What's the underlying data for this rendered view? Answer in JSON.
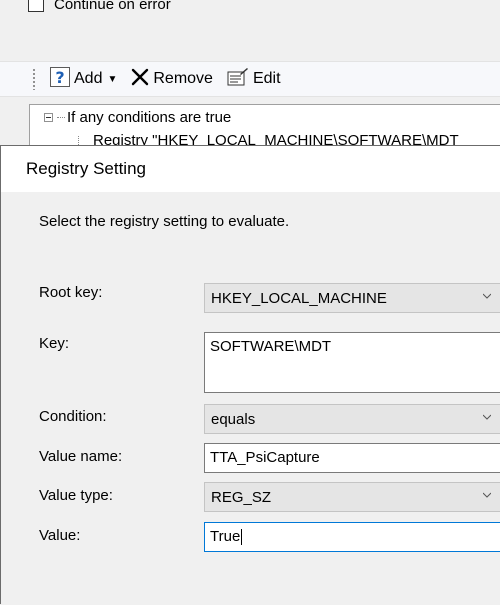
{
  "background": {
    "continue_on_error_label": "Continue on error",
    "toolbar": {
      "add_label": "Add",
      "remove_label": "Remove",
      "edit_label": "Edit"
    },
    "tree": {
      "root_label": "If any conditions are true",
      "child_label": "Registry \"HKEY_LOCAL_MACHINE\\SOFTWARE\\MDT"
    }
  },
  "dialog": {
    "title": "Registry Setting",
    "instruction": "Select the registry setting to evaluate.",
    "root_key": {
      "label": "Root key:",
      "value": "HKEY_LOCAL_MACHINE"
    },
    "key": {
      "label": "Key:",
      "value": "SOFTWARE\\MDT"
    },
    "condition": {
      "label": "Condition:",
      "value": "equals"
    },
    "value_name": {
      "label": "Value name:",
      "value": "TTA_PsiCapture"
    },
    "value_type": {
      "label": "Value type:",
      "value": "REG_SZ"
    },
    "value": {
      "label": "Value:",
      "value": "True"
    }
  },
  "icons": [
    "help-add-icon",
    "dropdown-caret-icon",
    "remove-x-icon",
    "edit-properties-icon",
    "chevron-down-icon"
  ],
  "colors": {
    "accent": "#0078d7",
    "help_icon": "#1e5fb4"
  }
}
